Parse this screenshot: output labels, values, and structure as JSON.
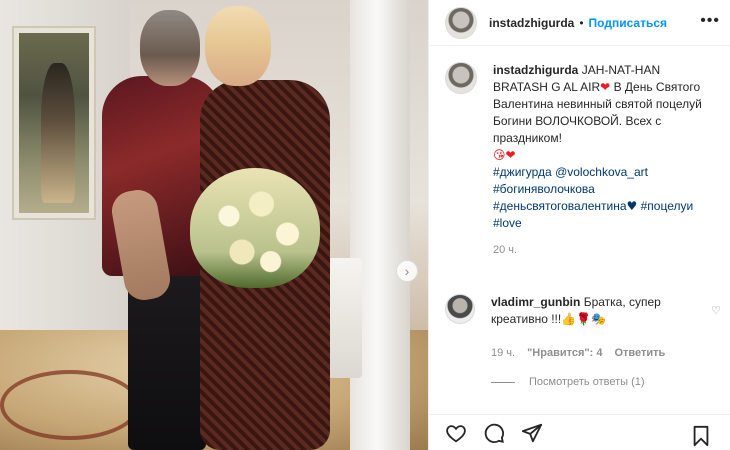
{
  "post": {
    "username": "instadzhigurda",
    "follow_label": "Подписаться",
    "more_label": "•••",
    "caption_username": "instadzhigurda",
    "caption_line1": "JAH-NAT-HAN BRATASH G AL AIR",
    "caption_line1_emoji": "❤",
    "caption_body": "В День Святого Валентина невинный святой поцелуй Богини ВОЛОЧКОВОЙ. Всех с праздником!",
    "caption_emojis": "😘❤",
    "hashtag1": "#джигурда",
    "mention": "@volochkova_art",
    "hashtag2": "#богиняволочкова",
    "hashtag3": "#деньсвятоговалентина",
    "hashtag3_emoji": "♥",
    "hashtag4": "#поцелуи",
    "hashtag5": "#love",
    "time": "20 ч."
  },
  "comment": {
    "username": "vladimr_gunbin",
    "text": "Братка, супер креативно !!!",
    "emojis": "👍🌹🎭",
    "heart_icon": "♡",
    "time": "19 ч.",
    "likes": "\"Нравится\": 4",
    "reply_label": "Ответить",
    "view_replies": "Посмотреть ответы (1)"
  },
  "photo": {
    "next_arrow": "›"
  },
  "colors": {
    "link": "#00376b",
    "follow": "#0095f6",
    "heart": "#ed1c24",
    "muted": "#8e8e8e"
  }
}
